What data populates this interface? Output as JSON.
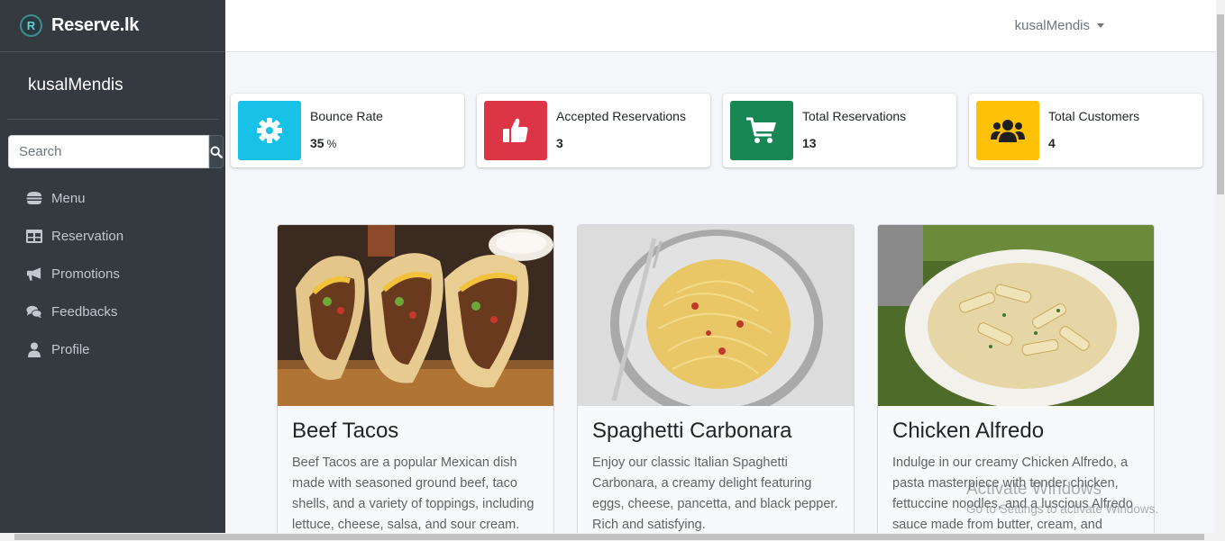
{
  "brand": {
    "name": "Reserve.lk",
    "logo_letter": "R"
  },
  "sidebar": {
    "user_name": "kusalMendis",
    "search_placeholder": "Search",
    "items": [
      {
        "label": "Menu",
        "icon": "hamburger-icon"
      },
      {
        "label": "Reservation",
        "icon": "table-icon"
      },
      {
        "label": "Promotions",
        "icon": "bullhorn-icon"
      },
      {
        "label": "Feedbacks",
        "icon": "comments-icon"
      },
      {
        "label": "Profile",
        "icon": "user-icon"
      }
    ]
  },
  "header": {
    "user_menu": "kusalMendis"
  },
  "stats": [
    {
      "label": "Bounce Rate",
      "value": "35",
      "unit": "%",
      "color": "#17c1e8",
      "icon": "gear-icon"
    },
    {
      "label": "Accepted Reservations",
      "value": "3",
      "color": "#dc3545",
      "icon": "thumbs-up-icon"
    },
    {
      "label": "Total Reservations",
      "value": "13",
      "color": "#198754",
      "icon": "cart-icon"
    },
    {
      "label": "Total Customers",
      "value": "4",
      "color": "#ffc107",
      "icon": "users-icon"
    }
  ],
  "cards": [
    {
      "title": "Beef Tacos",
      "text": "Beef Tacos are a popular Mexican dish made with seasoned ground beef, taco shells, and a variety of toppings, including lettuce, cheese, salsa, and sour cream."
    },
    {
      "title": "Spaghetti Carbonara",
      "text": "Enjoy our classic Italian Spaghetti Carbonara, a creamy delight featuring eggs, cheese, pancetta, and black pepper. Rich and satisfying."
    },
    {
      "title": "Chicken Alfredo",
      "text": "Indulge in our creamy Chicken Alfredo, a pasta masterpiece with tender chicken, fettuccine noodles, and a luscious Alfredo sauce made from butter, cream, and"
    }
  ],
  "watermark": {
    "line1": "Activate Windows",
    "line2": "Go to Settings to activate Windows."
  }
}
